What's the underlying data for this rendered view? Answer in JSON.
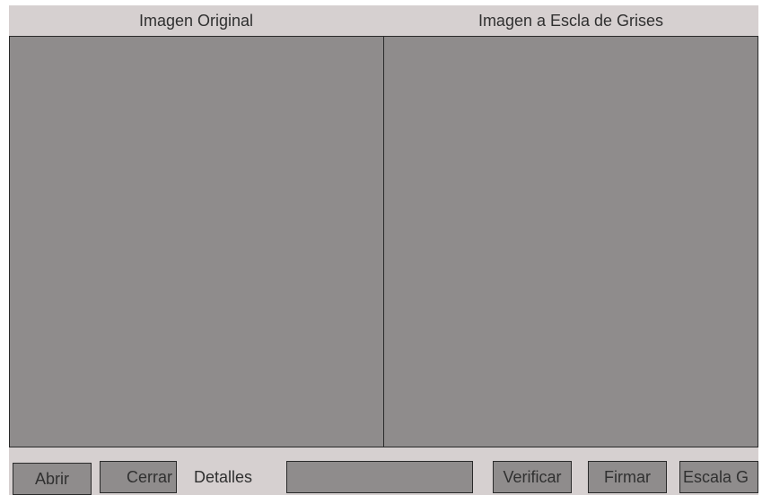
{
  "headers": {
    "original": "Imagen Original",
    "grayscale": "Imagen a Escla de Grises"
  },
  "toolbar": {
    "abrir_label": "Abrir",
    "cerrar_label": "Cerrar",
    "detalles_label": "Detalles",
    "detalles_value": "",
    "verificar_label": "Verificar",
    "firmar_label": "Firmar",
    "escala_label": "Escala G"
  },
  "colors": {
    "window_background": "#d6d0d0",
    "panel_fill": "#8f8c8c",
    "border": "#2a2a2a",
    "text": "#303030"
  }
}
